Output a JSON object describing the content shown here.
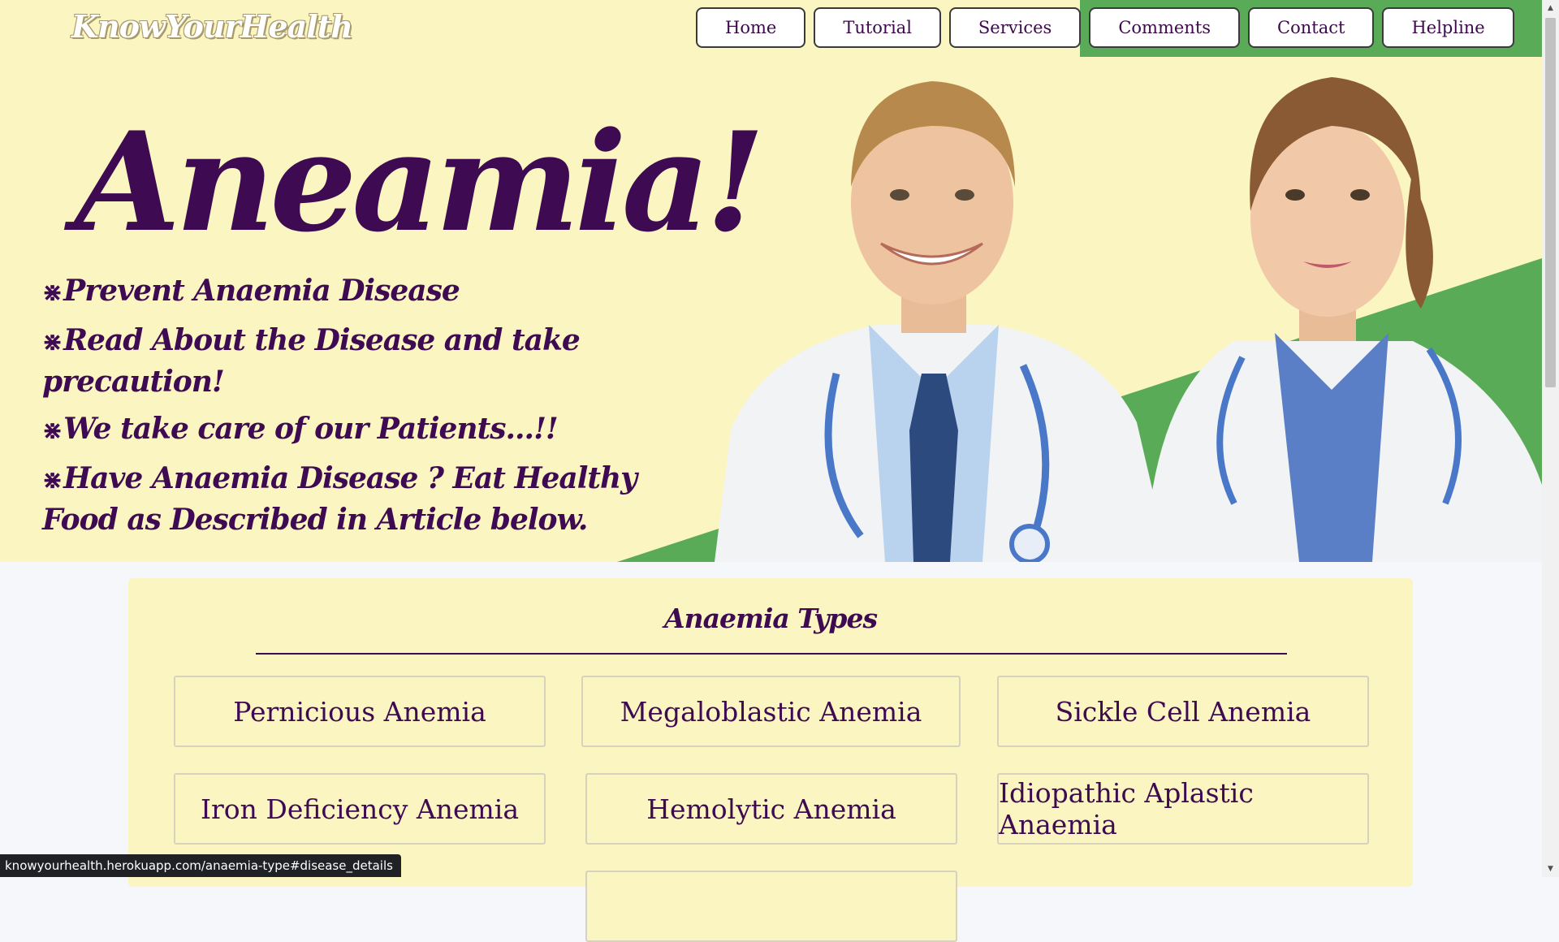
{
  "logo": "KnowYourHealth",
  "nav": [
    "Home",
    "Tutorial",
    "Services",
    "Comments",
    "Contact",
    "Helpline"
  ],
  "hero": {
    "title": "Aneamia!",
    "bullets": [
      "Prevent Anaemia Disease",
      "Read About the Disease and take precaution!",
      "We take care of our Patients...!!",
      "Have Anaemia Disease ? Eat Healthy Food as Described in Article below."
    ],
    "bullet_symbol": "⋇"
  },
  "types": {
    "title": "Anaemia Types",
    "items": [
      "Pernicious Anemia",
      "Megaloblastic Anemia",
      "Sickle Cell Anemia",
      "Iron Deficiency Anemia",
      "Hemolytic Anemia",
      "Idiopathic Aplastic Anaemia"
    ]
  },
  "status_url": "knowyourhealth.herokuapp.com/anaemia-type#disease_details",
  "colors": {
    "cream": "#faf5c1",
    "green": "#5aab57",
    "purple": "#3e0a52"
  },
  "icons": [
    "scroll-up-arrow-icon",
    "scroll-down-arrow-icon",
    "bullet-star-icon"
  ]
}
